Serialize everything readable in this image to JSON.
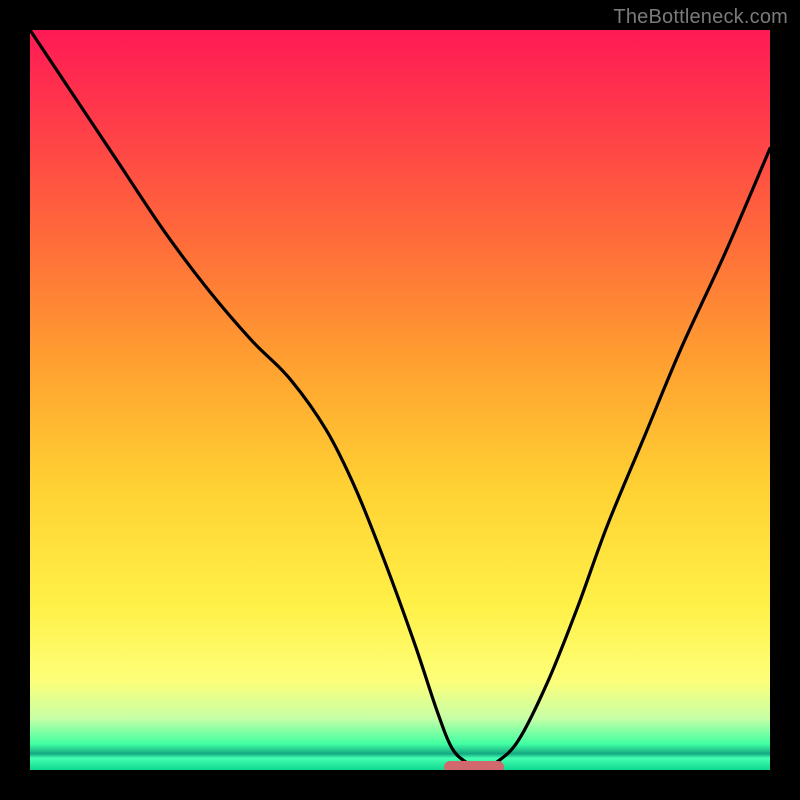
{
  "watermark": "TheBottleneck.com",
  "chart_data": {
    "type": "line",
    "title": "",
    "xlabel": "",
    "ylabel": "",
    "xlim": [
      0,
      100
    ],
    "ylim": [
      0,
      100
    ],
    "grid": false,
    "series": [
      {
        "name": "bottleneck-curve",
        "x": [
          0,
          6,
          12,
          18,
          24,
          30,
          35,
          40,
          44,
          48,
          52,
          55,
          57,
          59,
          61,
          63,
          66,
          70,
          74,
          78,
          83,
          88,
          94,
          100
        ],
        "y": [
          100,
          91,
          82,
          73,
          65,
          58,
          53,
          46,
          38,
          28,
          17,
          8,
          3,
          1,
          0,
          1,
          4,
          12,
          22,
          33,
          45,
          57,
          70,
          84
        ]
      }
    ],
    "marker": {
      "x_start": 56,
      "x_end": 64,
      "y": 0
    },
    "gradient_stops": [
      {
        "pos": 0,
        "color": "#ff1a55"
      },
      {
        "pos": 0.45,
        "color": "#ffa030"
      },
      {
        "pos": 0.78,
        "color": "#fff148"
      },
      {
        "pos": 0.97,
        "color": "#40ffa2"
      },
      {
        "pos": 1.0,
        "color": "#0fd890"
      }
    ]
  }
}
